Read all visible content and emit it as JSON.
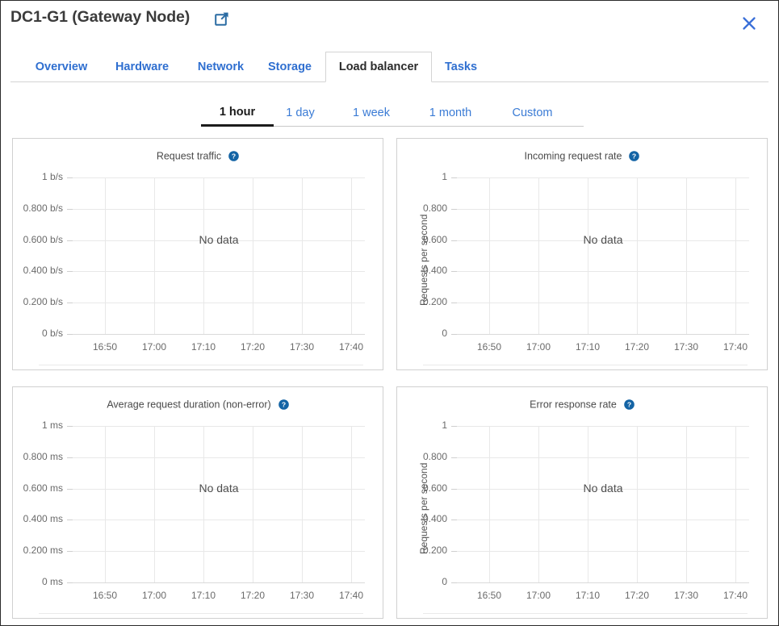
{
  "header": {
    "title": "DC1-G1 (Gateway Node)",
    "external_link_icon": "external-link-icon",
    "close_icon": "close-icon",
    "link_color": "#2f6fd0"
  },
  "tabs": [
    {
      "label": "Overview",
      "active": false
    },
    {
      "label": "Hardware",
      "active": false
    },
    {
      "label": "Network",
      "active": false
    },
    {
      "label": "Storage",
      "active": false
    },
    {
      "label": "Load balancer",
      "active": true
    },
    {
      "label": "Tasks",
      "active": false
    }
  ],
  "time_range_tabs": [
    {
      "label": "1 hour",
      "active": true
    },
    {
      "label": "1 day",
      "active": false
    },
    {
      "label": "1 week",
      "active": false
    },
    {
      "label": "1 month",
      "active": false
    },
    {
      "label": "Custom",
      "active": false
    }
  ],
  "no_data_text": "No data",
  "help_icon": "help-circle-icon",
  "chart_data": [
    {
      "type": "line",
      "title": "Request traffic",
      "xlabel": "",
      "ylabel": "",
      "ytick_labels": [
        "1 b/s",
        "0.800 b/s",
        "0.600 b/s",
        "0.400 b/s",
        "0.200 b/s",
        "0 b/s"
      ],
      "yvalues": [
        1,
        0.8,
        0.6,
        0.4,
        0.2,
        0
      ],
      "ylim": [
        0,
        1
      ],
      "xtick_labels": [
        "16:50",
        "17:00",
        "17:10",
        "17:20",
        "17:30",
        "17:40"
      ],
      "series": [],
      "grid": true,
      "legend": "none",
      "empty_message": "No data"
    },
    {
      "type": "line",
      "title": "Incoming request rate",
      "xlabel": "",
      "ylabel": "Requests per second",
      "ytick_labels": [
        "1",
        "0.800",
        "0.600",
        "0.400",
        "0.200",
        "0"
      ],
      "yvalues": [
        1,
        0.8,
        0.6,
        0.4,
        0.2,
        0
      ],
      "ylim": [
        0,
        1
      ],
      "xtick_labels": [
        "16:50",
        "17:00",
        "17:10",
        "17:20",
        "17:30",
        "17:40"
      ],
      "series": [],
      "grid": true,
      "legend": "none",
      "empty_message": "No data"
    },
    {
      "type": "line",
      "title": "Average request duration (non-error)",
      "xlabel": "",
      "ylabel": "",
      "ytick_labels": [
        "1 ms",
        "0.800 ms",
        "0.600 ms",
        "0.400 ms",
        "0.200 ms",
        "0 ms"
      ],
      "yvalues": [
        1,
        0.8,
        0.6,
        0.4,
        0.2,
        0
      ],
      "ylim": [
        0,
        1
      ],
      "xtick_labels": [
        "16:50",
        "17:00",
        "17:10",
        "17:20",
        "17:30",
        "17:40"
      ],
      "series": [],
      "grid": true,
      "legend": "none",
      "empty_message": "No data"
    },
    {
      "type": "line",
      "title": "Error response rate",
      "xlabel": "",
      "ylabel": "Requests per second",
      "ytick_labels": [
        "1",
        "0.800",
        "0.600",
        "0.400",
        "0.200",
        "0"
      ],
      "yvalues": [
        1,
        0.8,
        0.6,
        0.4,
        0.2,
        0
      ],
      "ylim": [
        0,
        1
      ],
      "xtick_labels": [
        "16:50",
        "17:00",
        "17:10",
        "17:20",
        "17:30",
        "17:40"
      ],
      "series": [],
      "grid": true,
      "legend": "none",
      "empty_message": "No data"
    }
  ]
}
